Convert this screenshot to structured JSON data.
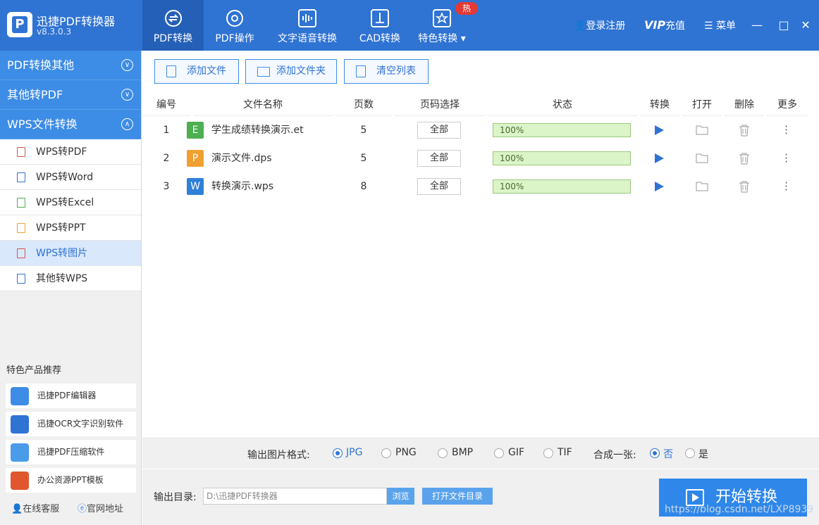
{
  "app": {
    "name": "迅捷PDF转换器",
    "version": "v8.3.0.3"
  },
  "nav": {
    "tabs": [
      {
        "label": "PDF转换"
      },
      {
        "label": "PDF操作"
      },
      {
        "label": "文字语音转换"
      },
      {
        "label": "CAD转换"
      },
      {
        "label": "特色转换"
      }
    ],
    "hot_badge": "热"
  },
  "topright": {
    "login": "登录注册",
    "vip": "VIP",
    "recharge": "充值",
    "menu": "菜单"
  },
  "sidebar": {
    "groups": [
      {
        "label": "PDF转换其他"
      },
      {
        "label": "其他转PDF"
      },
      {
        "label": "WPS文件转换"
      }
    ],
    "items": [
      {
        "label": "WPS转PDF"
      },
      {
        "label": "WPS转Word"
      },
      {
        "label": "WPS转Excel"
      },
      {
        "label": "WPS转PPT"
      },
      {
        "label": "WPS转图片"
      },
      {
        "label": "其他转WPS"
      }
    ],
    "reco_title": "特色产品推荐",
    "reco": [
      {
        "label": "迅捷PDF编辑器"
      },
      {
        "label": "迅捷OCR文字识别软件"
      },
      {
        "label": "迅捷PDF压缩软件"
      },
      {
        "label": "办公资源PPT模板"
      }
    ],
    "footer": {
      "service": "在线客服",
      "website": "官网地址"
    }
  },
  "toolbar": {
    "add_file": "添加文件",
    "add_folder": "添加文件夹",
    "clear_list": "清空列表"
  },
  "table": {
    "headers": [
      "编号",
      "文件名称",
      "页数",
      "页码选择",
      "状态",
      "转换",
      "打开",
      "删除",
      "更多"
    ],
    "rows": [
      {
        "no": "1",
        "type": "E",
        "type_color": "#4caf50",
        "name": "学生成绩转换演示.et",
        "pages": "5",
        "range": "全部",
        "status": "100%"
      },
      {
        "no": "2",
        "type": "P",
        "type_color": "#f0a030",
        "name": "演示文件.dps",
        "pages": "5",
        "range": "全部",
        "status": "100%"
      },
      {
        "no": "3",
        "type": "W",
        "type_color": "#2f80d8",
        "name": "转换演示.wps",
        "pages": "8",
        "range": "全部",
        "status": "100%"
      }
    ]
  },
  "format": {
    "label": "输出图片格式:",
    "options": [
      "JPG",
      "PNG",
      "BMP",
      "GIF",
      "TIF"
    ],
    "selected": "JPG",
    "merge_label": "合成一张:",
    "merge_options": [
      "否",
      "是"
    ],
    "merge_selected": "否"
  },
  "output": {
    "label": "输出目录:",
    "path": "D:\\迅捷PDF转换器",
    "browse": "浏览",
    "open_dir": "打开文件目录"
  },
  "start": {
    "label": "开始转换"
  },
  "watermark": "https://blog.csdn.net/LXP8939"
}
